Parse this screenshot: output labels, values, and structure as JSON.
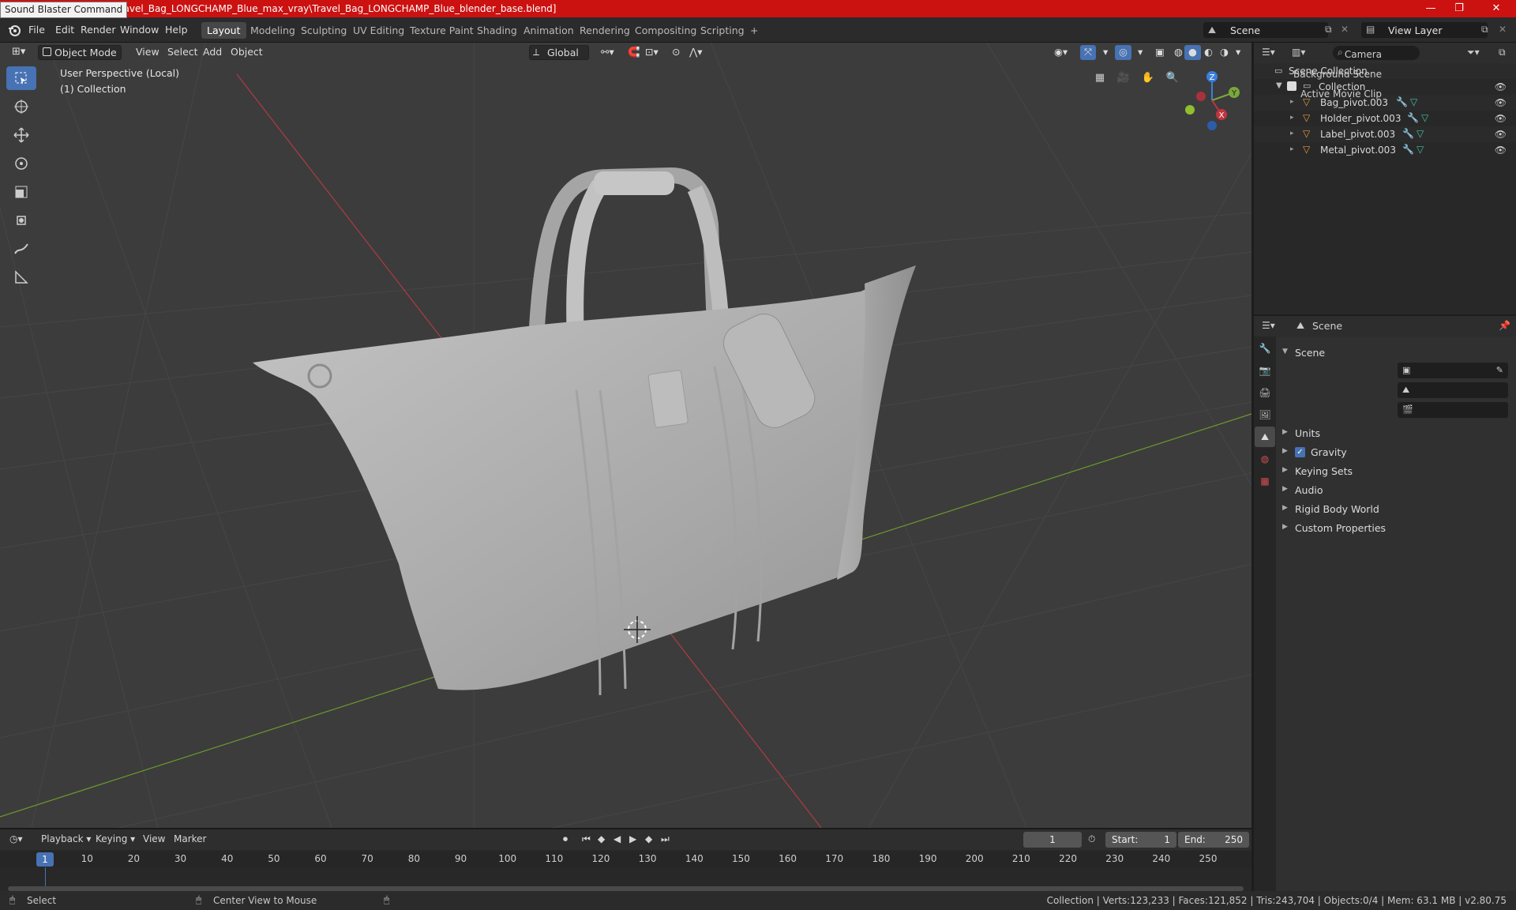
{
  "titlebar": {
    "tooltip": "Sound Blaster Command",
    "title": "\\Travel_Bag_LONGCHAMP_Blue_max_vray\\Travel_Bag_LONGCHAMP_Blue_blender_base.blend]",
    "minimize": "—",
    "maximize": "❐",
    "close": "✕"
  },
  "menu": {
    "items": [
      "File",
      "Edit",
      "Render",
      "Window",
      "Help"
    ],
    "workspaces": [
      "Layout",
      "Modeling",
      "Sculpting",
      "UV Editing",
      "Texture Paint",
      "Shading",
      "Animation",
      "Rendering",
      "Compositing",
      "Scripting",
      "+"
    ],
    "active_workspace": "Layout",
    "scene_field": "Scene",
    "view_layer_field": "View Layer"
  },
  "viewport": {
    "mode": "Object Mode",
    "menus": [
      "View",
      "Select",
      "Add",
      "Object"
    ],
    "transform_orientation": "Global",
    "perspective_label": "User Perspective (Local)",
    "collection_label": "(1) Collection",
    "gizmo": {
      "x": "X",
      "y": "Y",
      "z": "Z"
    },
    "colors": {
      "x_axis": "#c03440",
      "y_axis": "#7aa83a",
      "z_axis": "#3b7ee0",
      "bag": "#b5b5b5"
    }
  },
  "outliner": {
    "root": "Scene Collection",
    "collection": "Collection",
    "objects": [
      "Bag_pivot.003",
      "Holder_pivot.003",
      "Label_pivot.003",
      "Metal_pivot.003"
    ]
  },
  "properties": {
    "header": "Scene",
    "section": "Scene",
    "fields": [
      {
        "label": "Camera"
      },
      {
        "label": "Background Scene"
      },
      {
        "label": "Active Movie Clip"
      }
    ],
    "panels": [
      "Units",
      "Gravity",
      "Keying Sets",
      "Audio",
      "Rigid Body World",
      "Custom Properties"
    ]
  },
  "timeline": {
    "menus": [
      "Playback",
      "Keying",
      "View",
      "Marker"
    ],
    "current_frame": "1",
    "start_label": "Start:",
    "start": "1",
    "end_label": "End:",
    "end": "250",
    "ticks": [
      "1",
      "10",
      "20",
      "30",
      "40",
      "50",
      "60",
      "70",
      "80",
      "90",
      "100",
      "110",
      "120",
      "130",
      "140",
      "150",
      "160",
      "170",
      "180",
      "190",
      "200",
      "210",
      "220",
      "230",
      "240",
      "250"
    ]
  },
  "statusbar": {
    "select": "Select",
    "center_view": "Center View to Mouse",
    "stats": "Collection | Verts:123,233 | Faces:121,852 | Tris:243,704 | Objects:0/4 | Mem: 63.1 MB | v2.80.75"
  }
}
